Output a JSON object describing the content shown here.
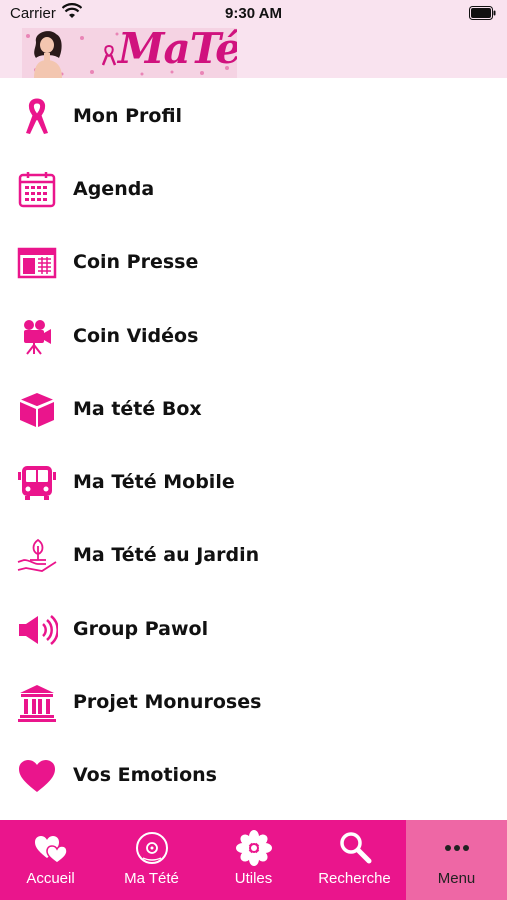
{
  "status_bar": {
    "carrier": "Carrier",
    "time": "9:30 AM"
  },
  "header": {
    "logo_text": "MaTété"
  },
  "brand_color": "#ea158c",
  "menu": [
    {
      "label": "Mon Profil",
      "icon": "ribbon-icon"
    },
    {
      "label": "Agenda",
      "icon": "calendar-icon"
    },
    {
      "label": "Coin Presse",
      "icon": "newspaper-icon"
    },
    {
      "label": "Coin Vidéos",
      "icon": "video-camera-icon"
    },
    {
      "label": "Ma tété Box",
      "icon": "box-icon"
    },
    {
      "label": "Ma Tété Mobile",
      "icon": "bus-icon"
    },
    {
      "label": "Ma Tété au Jardin",
      "icon": "plant-hand-icon"
    },
    {
      "label": "Group Pawol",
      "icon": "speaker-icon"
    },
    {
      "label": "Projet Monuroses",
      "icon": "building-icon"
    },
    {
      "label": "Vos Emotions",
      "icon": "heart-icon"
    }
  ],
  "tabs": [
    {
      "label": "Accueil",
      "icon": "hearts-icon"
    },
    {
      "label": "Ma Tété",
      "icon": "ma-tete-logo-icon"
    },
    {
      "label": "Utiles",
      "icon": "flower-icon"
    },
    {
      "label": "Recherche",
      "icon": "search-icon"
    },
    {
      "label": "Menu",
      "icon": "more-icon",
      "active": true
    }
  ]
}
